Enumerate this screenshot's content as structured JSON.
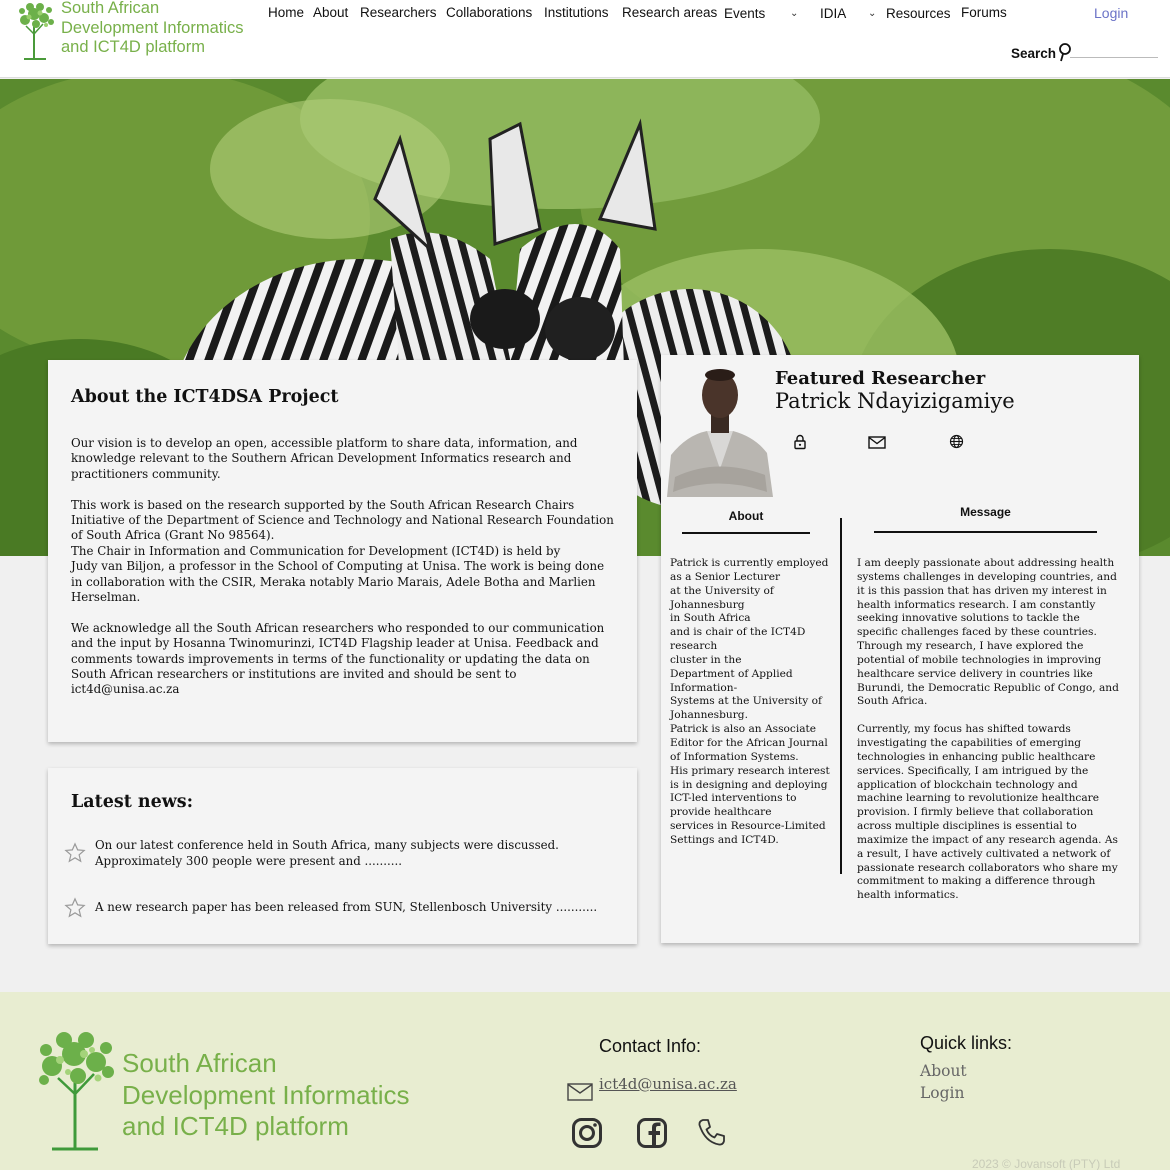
{
  "header": {
    "logo_lines": [
      "South African",
      "Development Informatics",
      "and ICT4D platform"
    ],
    "nav": [
      "Home",
      "About",
      "Researchers",
      "Collaborations",
      "Institutions",
      "Research areas",
      "Events",
      "IDIA",
      "Resources",
      "Forums"
    ],
    "login": "Login",
    "search_label": "Search",
    "search_placeholder": ""
  },
  "about": {
    "title": "About the ICT4DSA Project",
    "paragraphs": [
      "Our vision is to develop an open, accessible platform to share data, information, and\nknowledge relevant to the Southern African Development Informatics research and\npractitioners community.",
      "This work is based on the research supported by the South African Research Chairs\nInitiative of the Department of Science and Technology and National Research Foundation\nof South Africa (Grant No 98564).\nThe Chair in Information and Communication for Development (ICT4D) is held by\nJudy van Biljon, a professor in the School of Computing at Unisa. The work is being done\nin collaboration with the CSIR, Meraka notably Mario Marais, Adele Botha and Marlien\nHerselman.",
      "We acknowledge all the South African researchers who responded to our communication\nand the input by Hosanna Twinomurinzi, ICT4D Flagship leader at Unisa. Feedback and\ncomments towards improvements in terms of the functionality or updating the data on\nSouth African researchers or institutions are invited and should be sent to\nict4d@unisa.ac.za"
    ]
  },
  "news": {
    "title": "Latest news:",
    "items": [
      "On our latest conference held in South Africa, many subjects were discussed.\nApproximately 300 people were present and ..........",
      "A new research paper has been released from SUN, Stellenbosch University ..........."
    ]
  },
  "featured": {
    "heading": "Featured Researcher",
    "name": "Patrick Ndayizigamiye",
    "icons": [
      "lock-icon",
      "mail-icon",
      "globe-icon"
    ],
    "tab_about": "About",
    "tab_message": "Message",
    "about_text": "Patrick is currently employed\nas a Senior Lecturer\nat the University of\nJohannesburg\nin South Africa\nand is chair of the ICT4D\nresearch\ncluster in the\nDepartment of Applied\nInformation-\nSystems at the University of\nJohannesburg.\nPatrick is also an Associate\nEditor for the African Journal\nof Information Systems.\nHis primary research interest\nis in designing and deploying\nICT-led interventions to\nprovide healthcare\nservices in Resource-Limited\nSettings and ICT4D.",
    "message_text": " I am deeply passionate about addressing health\nsystems challenges in developing countries, and\nit is this passion that has driven my interest in\nhealth informatics research. I am constantly\nseeking innovative solutions to tackle the\nspecific challenges faced by these countries.\nThrough my research, I have explored the\npotential of mobile technologies in improving\nhealthcare service delivery in countries like\nBurundi, the Democratic Republic of Congo, and\nSouth Africa.\n\nCurrently, my focus has shifted towards\ninvestigating the capabilities of emerging\ntechnologies in enhancing public healthcare\nservices. Specifically, I am intrigued by the\napplication of blockchain technology and\nmachine learning to revolutionize healthcare\nprovision. I firmly believe that collaboration\nacross multiple disciplines is essential to\nmaximize the impact of any research agenda. As\na result, I have actively cultivated a network of\npassionate research collaborators who share my\ncommitment to making a difference through\nhealth informatics."
  },
  "footer": {
    "logo_lines": [
      "South African",
      "Development Informatics",
      "and ICT4D platform"
    ],
    "contact_title": "Contact Info:",
    "contact_email": "ict4d@unisa.ac.za",
    "social_icons": [
      "instagram-icon",
      "facebook-icon",
      "phone-icon"
    ],
    "quick_links_title": "Quick links:",
    "quick_links": [
      "About",
      "Login"
    ],
    "copyright": "2023 © Jovansoft (PTY) Ltd"
  },
  "colors": {
    "brand_green": "#78b04a",
    "login_blue": "#6b73c7",
    "footer_bg": "#e8edd1"
  }
}
